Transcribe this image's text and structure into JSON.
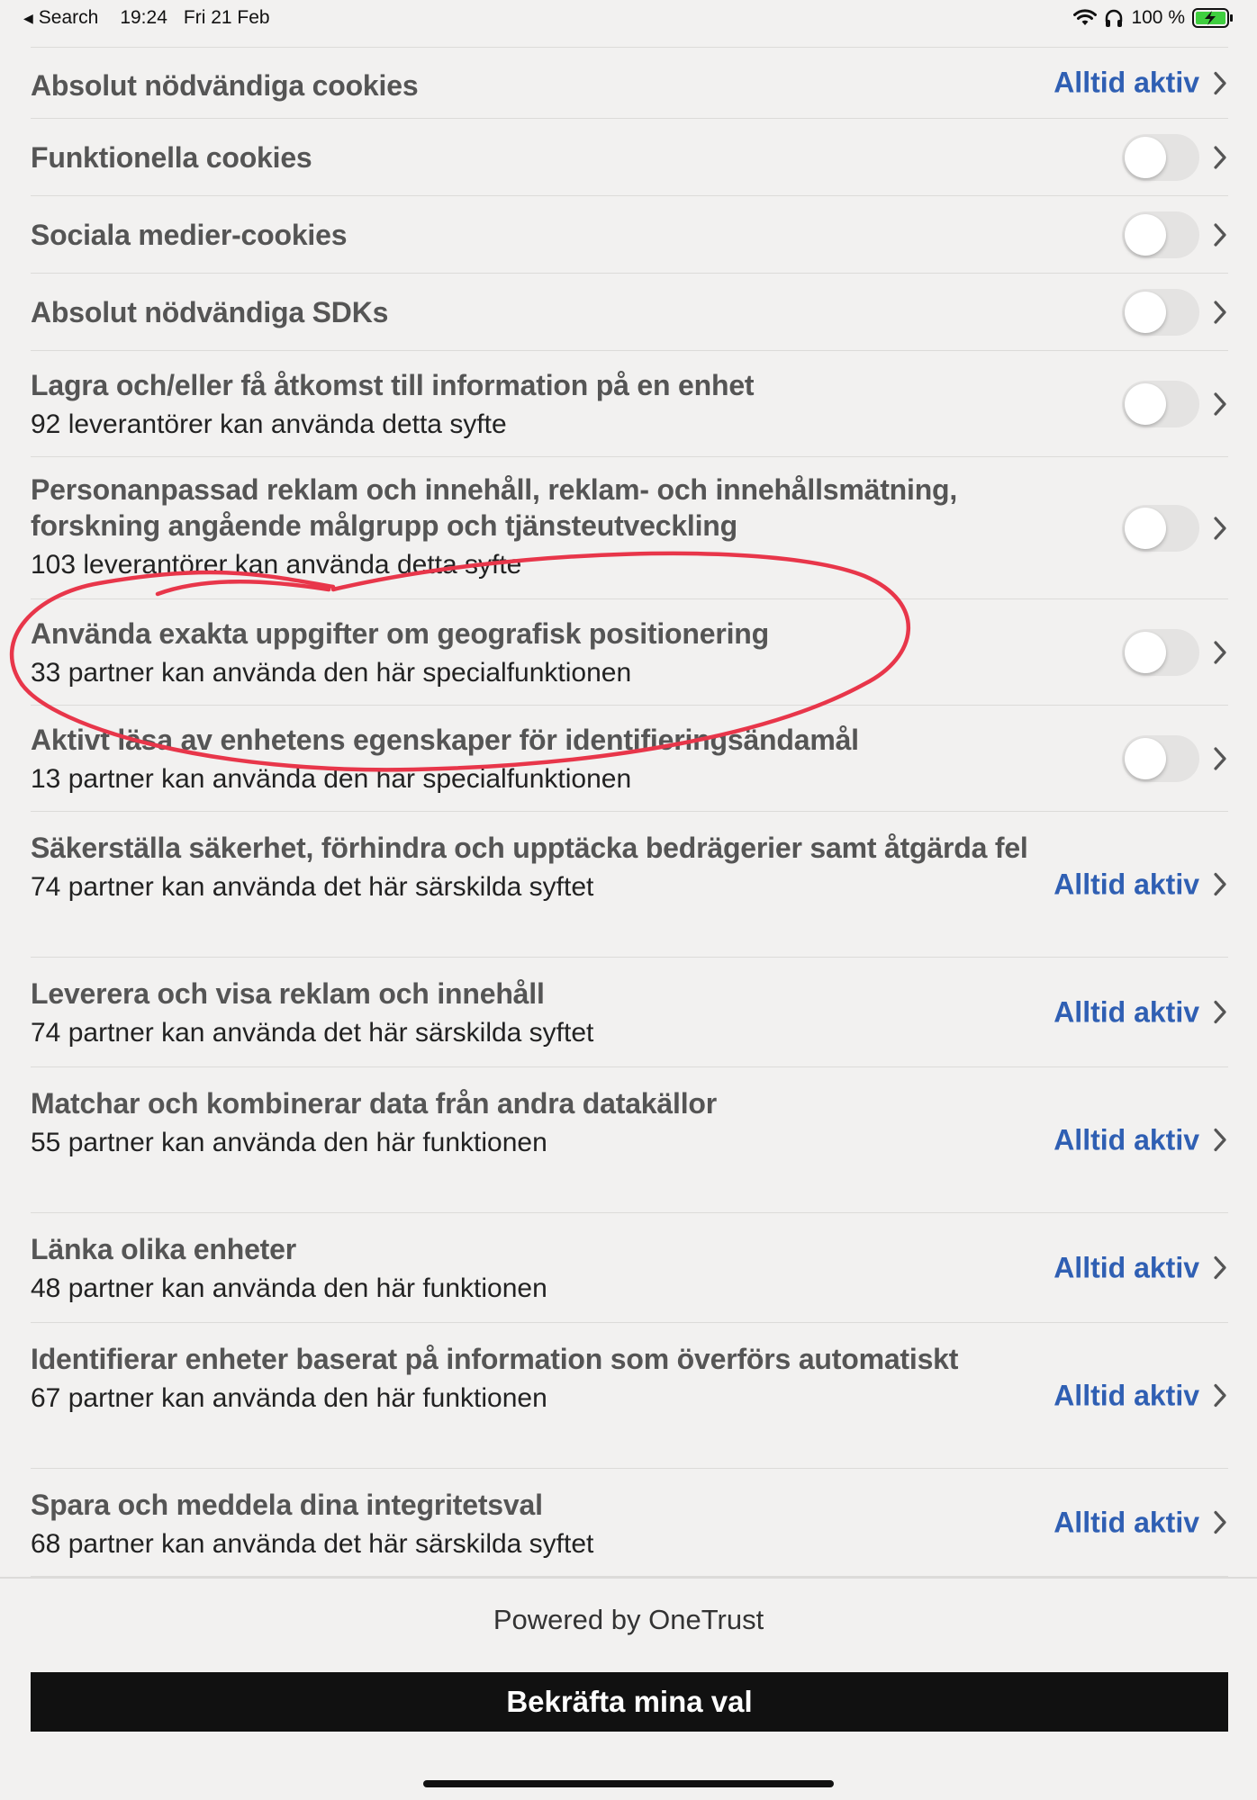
{
  "status_bar": {
    "back_label": "Search",
    "time": "19:24",
    "date": "Fri 21 Feb",
    "battery": "100 %",
    "icons": [
      "wifi-icon",
      "headphones-icon",
      "battery-charging-icon"
    ]
  },
  "rows": [
    {
      "title": "Absolut nödvändiga cookies",
      "subtitle": "",
      "control": "always",
      "status": "Alltid aktiv"
    },
    {
      "title": "Funktionella cookies",
      "subtitle": "",
      "control": "toggle",
      "on": false
    },
    {
      "title": "Sociala medier-cookies",
      "subtitle": "",
      "control": "toggle",
      "on": false
    },
    {
      "title": "Absolut nödvändiga SDKs",
      "subtitle": "",
      "control": "toggle",
      "on": false
    },
    {
      "title": "Lagra och/eller få åtkomst till information på en enhet",
      "subtitle": "92 leverantörer kan använda detta syfte",
      "control": "toggle",
      "on": false
    },
    {
      "title": "Personanpassad reklam och innehåll, reklam- och innehållsmätning, forskning angående målgrupp och tjänsteutveckling",
      "subtitle": "103 leverantörer kan använda detta syfte",
      "control": "toggle",
      "on": false
    },
    {
      "title": "Använda exakta uppgifter om geografisk positionering",
      "subtitle": "33 partner kan använda den här specialfunktionen",
      "control": "toggle",
      "on": false
    },
    {
      "title": "Aktivt läsa av enhetens egenskaper för identifieringsändamål",
      "subtitle": "13 partner kan använda den här specialfunktionen",
      "control": "toggle",
      "on": false
    },
    {
      "title": "Säkerställa säkerhet, förhindra och upptäcka bedrägerier samt åtgärda fel",
      "subtitle": "74 partner kan använda det här särskilda syftet",
      "control": "always",
      "status": "Alltid aktiv"
    },
    {
      "title": "Leverera och visa reklam och innehåll",
      "subtitle": "74 partner kan använda det här särskilda syftet",
      "control": "always",
      "status": "Alltid aktiv"
    },
    {
      "title": "Matchar och kombinerar data från andra datakällor",
      "subtitle": "55 partner kan använda den här funktionen",
      "control": "always",
      "status": "Alltid aktiv"
    },
    {
      "title": "Länka olika enheter",
      "subtitle": "48 partner kan använda den här funktionen",
      "control": "always",
      "status": "Alltid aktiv"
    },
    {
      "title": "Identifierar enheter baserat på information som överförs automatiskt",
      "subtitle": "67 partner kan använda den här funktionen",
      "control": "always",
      "status": "Alltid aktiv"
    },
    {
      "title": "Spara och meddela dina integritetsval",
      "subtitle": "68 partner kan använda det här särskilda syftet",
      "control": "always",
      "status": "Alltid aktiv"
    }
  ],
  "footer": {
    "powered_by": "Powered by OneTrust",
    "confirm_label": "Bekräfta mina val"
  },
  "colors": {
    "background": "#f2f1f0",
    "accent": "#2f5fb3",
    "annotation": "#e8364a",
    "button": "#111111"
  }
}
